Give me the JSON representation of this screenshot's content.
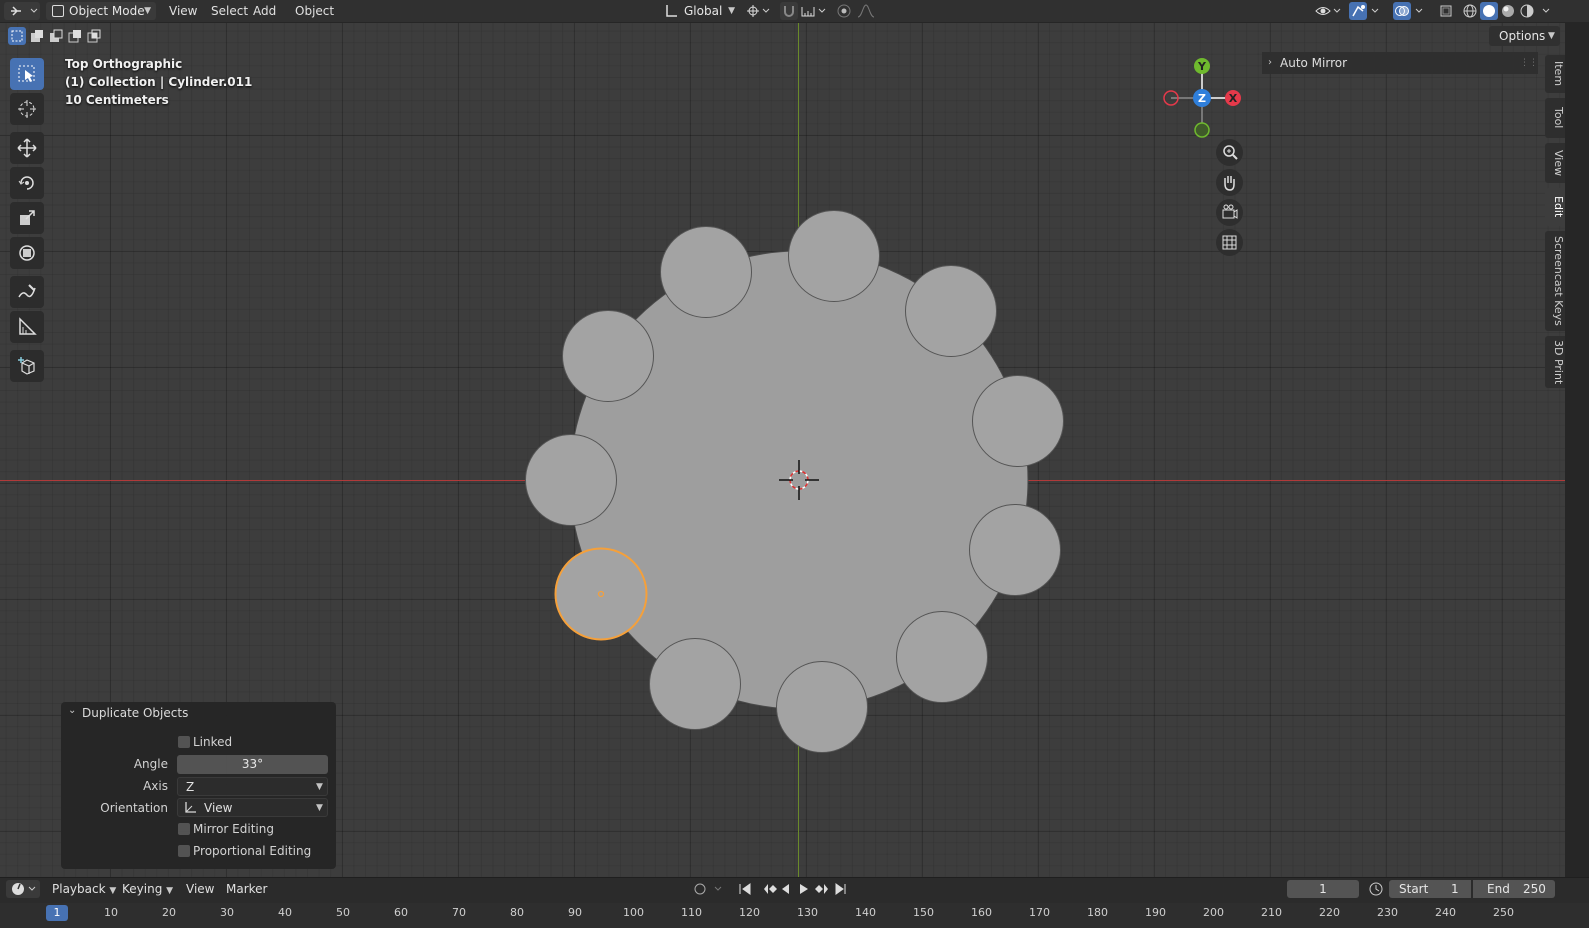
{
  "header": {
    "mode": "Object Mode",
    "menus": [
      "View",
      "Select",
      "Add",
      "Object"
    ],
    "orientation": "Global",
    "options": "Options"
  },
  "viewport": {
    "view_name": "Top Orthographic",
    "collection": "(1) Collection | Cylinder.011",
    "scale": "10 Centimeters",
    "gizmo": {
      "y": "Y",
      "z": "Z",
      "x": "X"
    }
  },
  "auto_mirror": "Auto Mirror",
  "sidetabs": [
    "Item",
    "Tool",
    "View",
    "Edit",
    "Screencast Keys",
    "3D Print"
  ],
  "operator_panel": {
    "title": "Duplicate Objects",
    "linked": "Linked",
    "angle_label": "Angle",
    "angle_value": "33°",
    "axis_label": "Axis",
    "axis_value": "Z",
    "orientation_label": "Orientation",
    "orientation_value": "View",
    "mirror_editing": "Mirror Editing",
    "proportional_editing": "Proportional Editing"
  },
  "timeline": {
    "menus": [
      "Playback",
      "Keying",
      "View",
      "Marker"
    ],
    "current_frame": "1",
    "start_label": "Start",
    "start": "1",
    "end_label": "End",
    "end": "250",
    "frame_marker": "1",
    "ticks": [
      "10",
      "20",
      "30",
      "40",
      "50",
      "60",
      "70",
      "80",
      "90",
      "100",
      "110",
      "120",
      "130",
      "140",
      "150",
      "160",
      "170",
      "180",
      "190",
      "200",
      "210",
      "220",
      "230",
      "240",
      "250"
    ]
  },
  "colors": {
    "selected_outline": "#f5a03a",
    "x_axis": "#b03a3a",
    "y_axis": "#6a8a2a",
    "accent": "#4772b3"
  }
}
